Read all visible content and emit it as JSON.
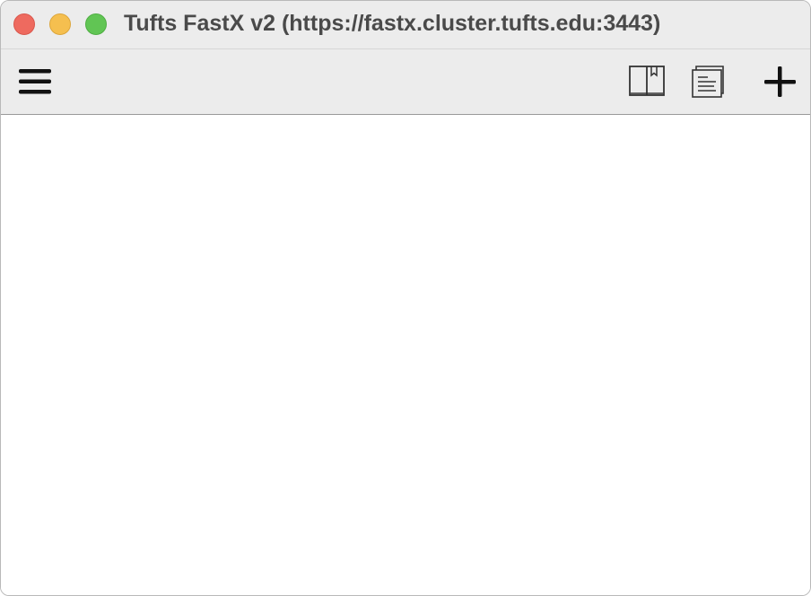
{
  "window": {
    "title": "Tufts FastX v2 (https://fastx.cluster.tufts.edu:3443)"
  },
  "toolbar": {
    "menu_icon": "hamburger-menu-icon",
    "bookmarks_icon": "book-bookmark-icon",
    "sessions_icon": "document-list-icon",
    "add_icon": "plus-icon"
  },
  "colors": {
    "close": "#ee6a5f",
    "minimize": "#f5bf4f",
    "maximize": "#61c554",
    "toolbar_bg": "#ececec"
  }
}
